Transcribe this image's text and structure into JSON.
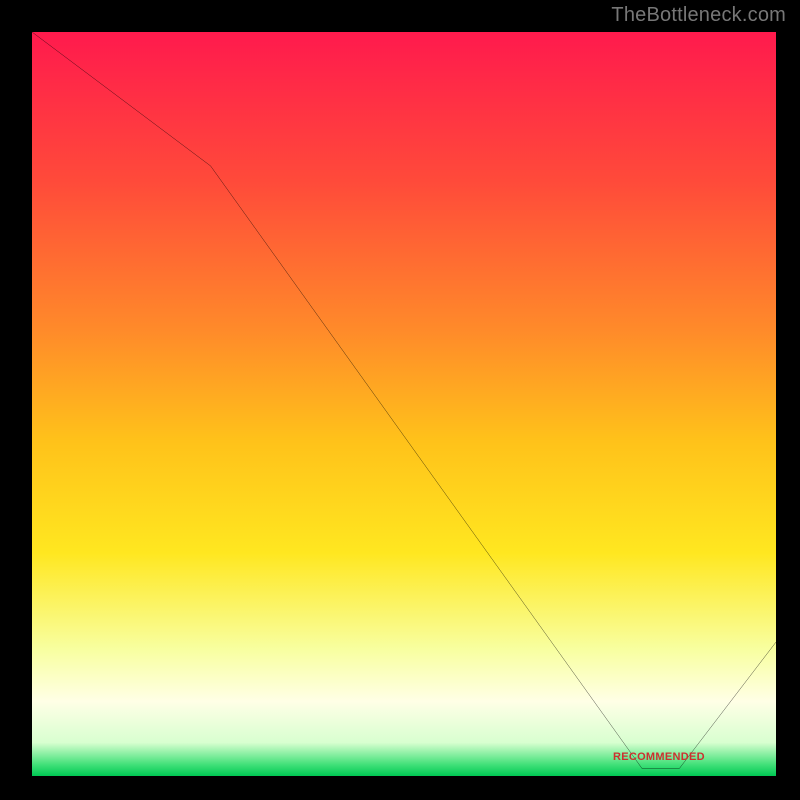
{
  "watermark": "TheBottleneck.com",
  "annotation_label": "RECOMMENDED",
  "chart_data": {
    "type": "line",
    "title": "",
    "xlabel": "",
    "ylabel": "",
    "xlim": [
      0,
      100
    ],
    "ylim": [
      0,
      100
    ],
    "x": [
      0,
      24,
      82,
      87,
      100
    ],
    "values": [
      100,
      82,
      1,
      1,
      18
    ],
    "annotation": {
      "x": 84,
      "y": 2,
      "text": "RECOMMENDED"
    },
    "gradient_stops": [
      {
        "offset": 0.0,
        "color": "#ff1a4d"
      },
      {
        "offset": 0.2,
        "color": "#ff4a3a"
      },
      {
        "offset": 0.4,
        "color": "#ff8a2a"
      },
      {
        "offset": 0.55,
        "color": "#ffc21a"
      },
      {
        "offset": 0.7,
        "color": "#ffe720"
      },
      {
        "offset": 0.83,
        "color": "#f8ffa0"
      },
      {
        "offset": 0.9,
        "color": "#ffffe6"
      },
      {
        "offset": 0.955,
        "color": "#d8ffd0"
      },
      {
        "offset": 0.985,
        "color": "#40e078"
      },
      {
        "offset": 1.0,
        "color": "#00c853"
      }
    ]
  }
}
